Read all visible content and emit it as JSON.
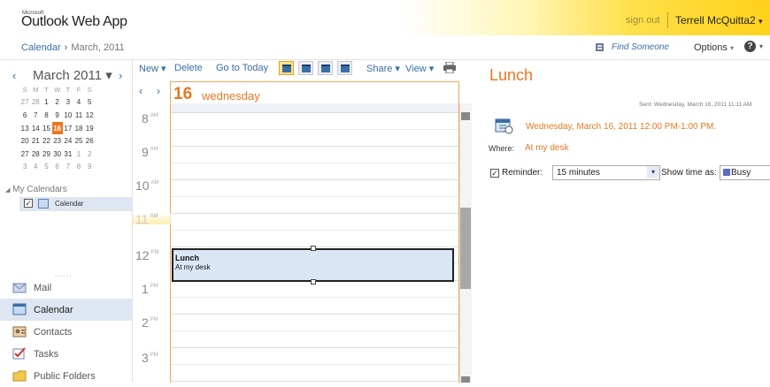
{
  "header": {
    "logo_small": "Microsoft",
    "app_title": "Outlook Web App",
    "sign_out": "sign out",
    "user_name": "Terrell McQuitta2",
    "user_caret": "▾"
  },
  "breadcrumb": {
    "root": "Calendar",
    "separator": "›",
    "current": "March, 2011"
  },
  "topnav": {
    "find_someone": "Find Someone",
    "options": "Options",
    "options_caret": "▾",
    "help": "?",
    "help_caret": "▾"
  },
  "mini_calendar": {
    "prev": "‹",
    "next": "›",
    "month_label": "March 2011 ▾",
    "weekdays": [
      "S",
      "M",
      "T",
      "W",
      "T",
      "F",
      "S"
    ],
    "weeks": [
      [
        "27",
        "28",
        "1",
        "2",
        "3",
        "4",
        "5"
      ],
      [
        "6",
        "7",
        "8",
        "9",
        "10",
        "11",
        "12"
      ],
      [
        "13",
        "14",
        "15",
        "16",
        "17",
        "18",
        "19"
      ],
      [
        "20",
        "21",
        "22",
        "23",
        "24",
        "25",
        "26"
      ],
      [
        "27",
        "28",
        "29",
        "30",
        "31",
        "1",
        "2"
      ],
      [
        "3",
        "4",
        "5",
        "6",
        "7",
        "8",
        "9"
      ]
    ],
    "today": "16"
  },
  "my_calendars": {
    "heading": "My Calendars",
    "items": [
      {
        "label": "Calendar",
        "checked": "✓"
      }
    ]
  },
  "nav": {
    "grip": "......",
    "items": [
      {
        "label": "Mail",
        "icon": "mail-icon"
      },
      {
        "label": "Calendar",
        "icon": "calendar-icon"
      },
      {
        "label": "Contacts",
        "icon": "contacts-icon"
      },
      {
        "label": "Tasks",
        "icon": "tasks-icon"
      },
      {
        "label": "Public Folders",
        "icon": "public-folders-icon"
      }
    ]
  },
  "toolbar": {
    "new": "New ▾",
    "delete": "Delete",
    "goto_today": "Go to Today",
    "share": "Share ▾",
    "view": "View ▾"
  },
  "day_view": {
    "prev": "‹",
    "next": "›",
    "day_number": "16",
    "day_name": "wednesday",
    "hours": [
      {
        "num": "8",
        "ampm": "AM"
      },
      {
        "num": "9",
        "ampm": "AM"
      },
      {
        "num": "10",
        "ampm": "AM"
      },
      {
        "num": "11",
        "ampm": "AM"
      },
      {
        "num": "12",
        "ampm": "PM"
      },
      {
        "num": "1",
        "ampm": "PM"
      },
      {
        "num": "2",
        "ampm": "PM"
      },
      {
        "num": "3",
        "ampm": "PM"
      }
    ],
    "event": {
      "title": "Lunch",
      "location": "At my desk"
    }
  },
  "reading_pane": {
    "title": "Lunch",
    "sent": "Sent: Wednesday, March 16, 2011 11:11 AM",
    "when": "Wednesday, March 16, 2011 12:00 PM-1:00 PM.",
    "where_label": "Where:",
    "where": "At my desk",
    "reminder_checked": "✓",
    "reminder_label": "Reminder:",
    "reminder_value": "15 minutes",
    "reminder_arrow": "▾",
    "show_as_label": "Show time as:",
    "show_as_value": "Busy"
  },
  "colors": {
    "accent": "#e87722",
    "link": "#3a6ea5",
    "selected": "#dde6f1",
    "busy": "#5a6cc4"
  }
}
